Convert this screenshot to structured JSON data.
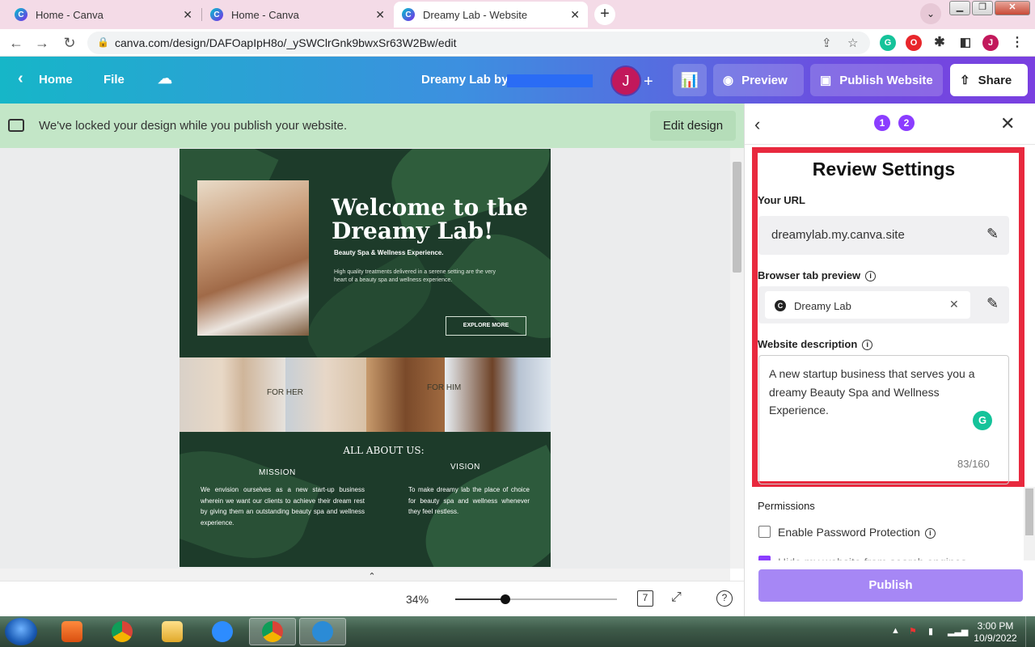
{
  "browser": {
    "tabs": [
      {
        "title": "Home - Canva",
        "active": false
      },
      {
        "title": "Home - Canva",
        "active": false
      },
      {
        "title": "Dreamy Lab - Website",
        "active": true
      }
    ],
    "new_tab_symbol": "+",
    "url": "canva.com/design/DAFOapIpH8o/_ySWClrGnk9bwxSr63W2Bw/edit",
    "profile_initial": "J"
  },
  "canva_header": {
    "home_label": "Home",
    "file_label": "File",
    "design_title": "Dreamy Lab by",
    "avatar_initial": "J",
    "preview_label": "Preview",
    "publish_website_label": "Publish Website",
    "share_label": "Share"
  },
  "lock_banner": {
    "message": "We've locked your design while you publish your website.",
    "edit_button": "Edit design"
  },
  "site_preview": {
    "hero_title": "Welcome to the Dreamy Lab!",
    "hero_subtitle": "Beauty Spa & Wellness Experience.",
    "hero_description": "High quality treatments delivered in a serene setting are the very heart of a beauty spa and wellness experience.",
    "explore_button": "EXPLORE MORE",
    "for_her": "FOR HER",
    "for_him": "FOR HIM",
    "about_title": "ALL ABOUT US:",
    "mission_heading": "MISSION",
    "mission_text": "We envision ourselves as a new start-up business wherein we want our clients to achieve their dream rest by giving them an outstanding beauty spa and wellness experience.",
    "vision_heading": "VISION",
    "vision_text": "To make dreamy lab the place of choice for beauty spa and wellness whenever they feel restless."
  },
  "bottom_bar": {
    "zoom": "34%",
    "zoom_fraction": 0.31,
    "page_count": "7"
  },
  "panel": {
    "steps": [
      "1",
      "2"
    ],
    "title": "Review Settings",
    "url_label": "Your URL",
    "url_value": "dreamylab.my.canva.site",
    "tab_preview_label": "Browser tab preview",
    "tab_preview_value": "Dreamy Lab",
    "description_label": "Website description",
    "description_value": "A new startup business that serves you a dreamy Beauty Spa and Wellness Experience.",
    "char_count": "83/160",
    "permissions_label": "Permissions",
    "password_option": "Enable Password Protection",
    "search_engine_option": "Hide my website from search engines",
    "publish_button": "Publish"
  },
  "taskbar": {
    "time": "3:00 PM",
    "date": "10/9/2022"
  },
  "colors": {
    "canva_purple": "#8b3dff",
    "highlight_red": "#e8293e",
    "banner_green": "#c3e6c7",
    "publish_button": "#a687f5"
  }
}
